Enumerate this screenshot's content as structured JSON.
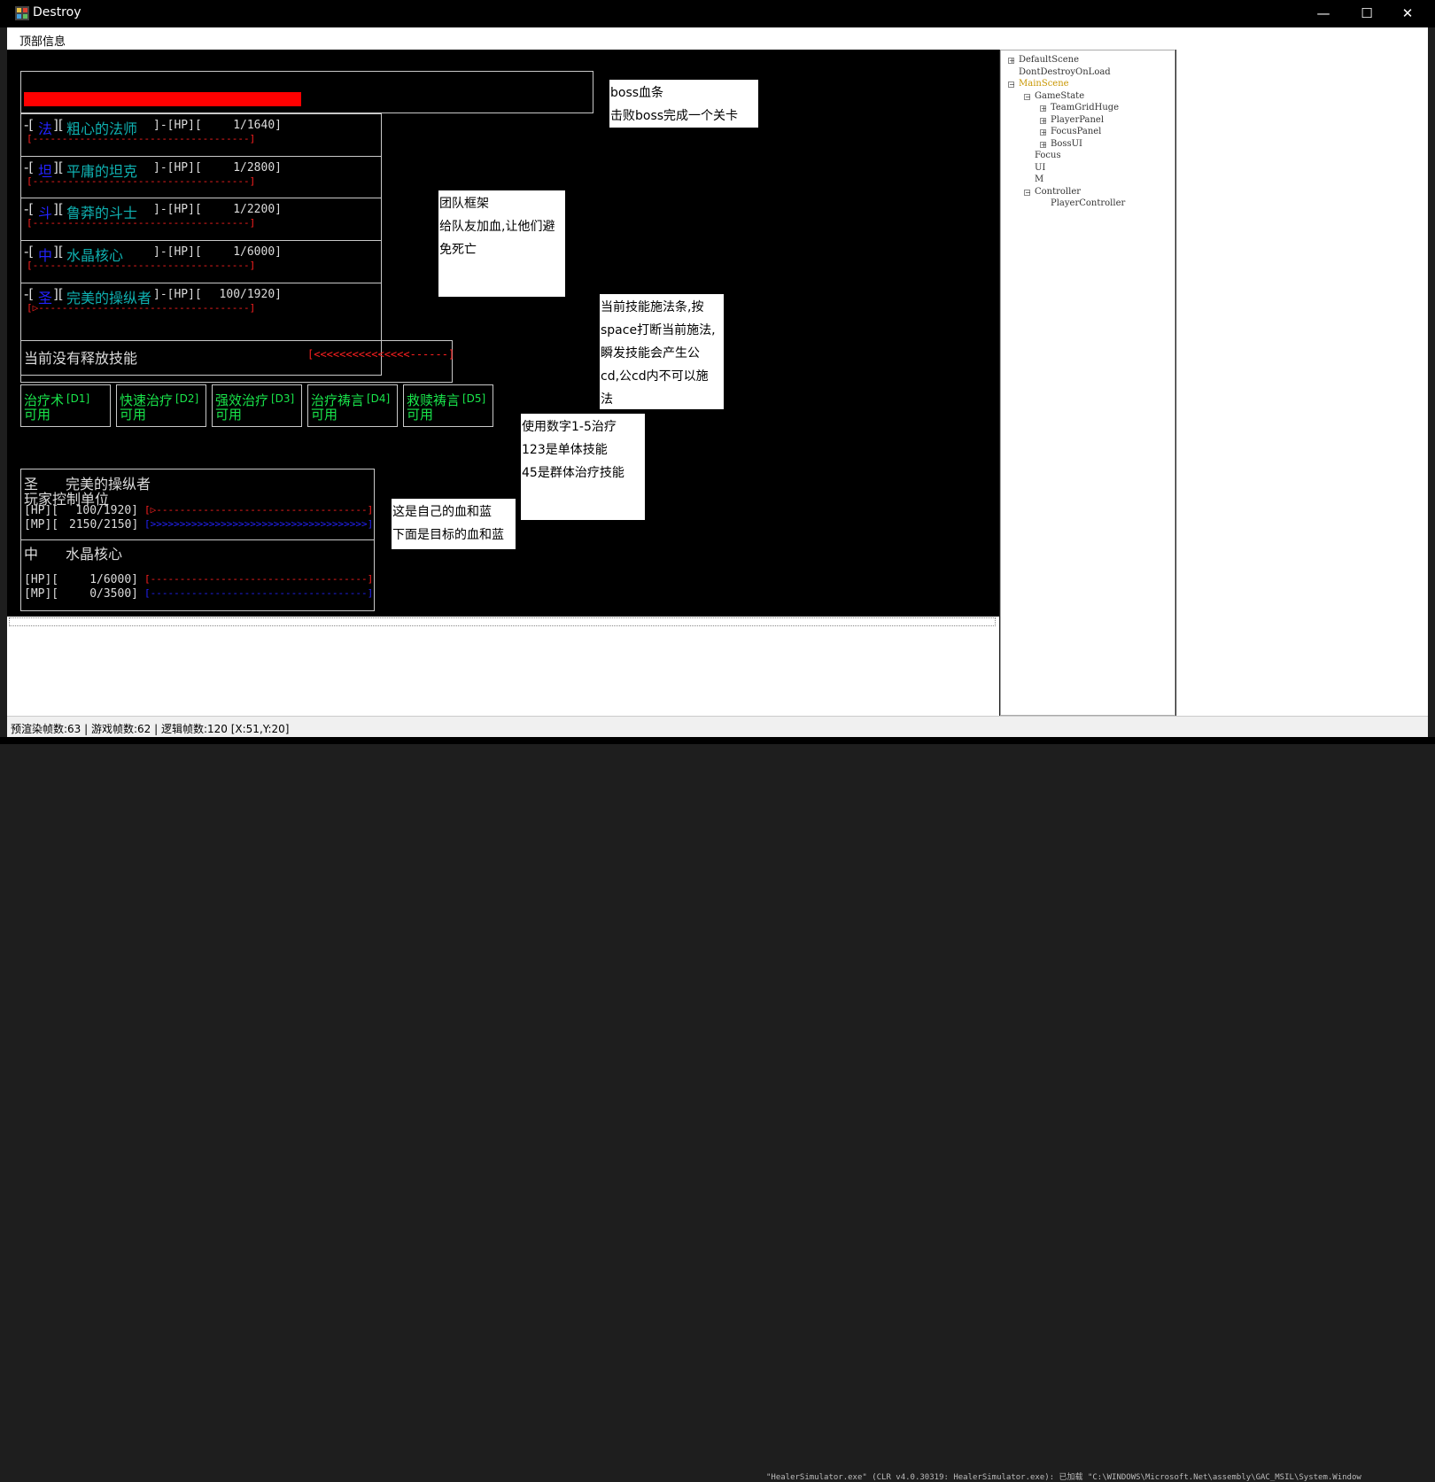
{
  "window": {
    "title": "Destroy",
    "minimize": "—",
    "maximize": "☐",
    "close": "✕"
  },
  "menu": {
    "top_info": "顶部信息"
  },
  "boss": {
    "hp_fraction": 0.49
  },
  "team": [
    {
      "bracket_open": "-[",
      "role": "法",
      "mid": "][",
      "name": "粗心的法师",
      "hp_label": "]-[HP][",
      "hp": "1/1640]",
      "bar": "[-------------------------------------]",
      "hp_fraction": 0.001
    },
    {
      "bracket_open": "-[",
      "role": "坦",
      "mid": "][",
      "name": "平庸的坦克",
      "hp_label": "]-[HP][",
      "hp": "1/2800]",
      "bar": "[-------------------------------------]",
      "hp_fraction": 0.001
    },
    {
      "bracket_open": "-[",
      "role": "斗",
      "mid": "][",
      "name": "鲁莽的斗士",
      "hp_label": "]-[HP][",
      "hp": "1/2200]",
      "bar": "[-------------------------------------]",
      "hp_fraction": 0.001
    },
    {
      "bracket_open": "-[",
      "role": "中",
      "mid": "][",
      "name": "水晶核心",
      "hp_label": "]-[HP][",
      "hp": "1/6000]",
      "bar": "[-------------------------------------]",
      "hp_fraction": 0.001
    },
    {
      "bracket_open": "-[",
      "role": "圣",
      "mid": "][",
      "name": "完美的操纵者",
      "hp_label": "]-[HP][",
      "hp": "100/1920]",
      "bar": "[▷------------------------------------]",
      "hp_fraction": 0.05
    }
  ],
  "cast": {
    "status": "当前没有释放技能",
    "bar": "[<<<<<<<<<<<<<<<------]"
  },
  "skills": [
    {
      "name": "治疗术",
      "key": "[D1]",
      "state": "可用"
    },
    {
      "name": "快速治疗",
      "key": "[D2]",
      "state": "可用"
    },
    {
      "name": "强效治疗",
      "key": "[D3]",
      "state": "可用"
    },
    {
      "name": "治疗祷言",
      "key": "[D4]",
      "state": "可用"
    },
    {
      "name": "救赎祷言",
      "key": "[D5]",
      "state": "可用"
    }
  ],
  "self": {
    "role": "圣",
    "name": "完美的操纵者",
    "type": "玩家控制单位",
    "hp_label": "[HP][",
    "hp": "100/1920]",
    "hp_bar": "[▷------------------------------------]",
    "mp_label": "[MP][",
    "mp": "2150/2150]",
    "mp_bar": "[>>>>>>>>>>>>>>>>>>>>>>>>>>>>>>>>>>>>>]"
  },
  "target": {
    "role": "中",
    "name": "水晶核心",
    "hp_label": "[HP][",
    "hp": "1/6000]",
    "hp_bar": "[-------------------------------------]",
    "mp_label": "[MP][",
    "mp": "0/3500]",
    "mp_bar": "[-------------------------------------]"
  },
  "notes": {
    "boss": "boss血条\n击败boss完成一个关卡",
    "team": "团队框架\n给队友加血,让他们避\n免死亡",
    "cast": "当前技能施法条,按\nspace打断当前施法,\n瞬发技能会产生公\ncd,公cd内不可以施\n法",
    "skills": "使用数字1-5治疗\n123是单体技能\n45是群体治疗技能",
    "self": "这是自己的血和蓝\n下面是目标的血和蓝"
  },
  "tree": [
    {
      "label": "DefaultScene",
      "box": "+"
    },
    {
      "label": "DontDestroyOnLoad",
      "box": ""
    },
    {
      "label": "MainScene",
      "box": "-"
    },
    {
      "label": "GameState",
      "box": "-"
    },
    {
      "label": "TeamGridHuge",
      "box": "+"
    },
    {
      "label": "PlayerPanel",
      "box": "+"
    },
    {
      "label": "FocusPanel",
      "box": "+"
    },
    {
      "label": "BossUI",
      "box": "+"
    },
    {
      "label": "Focus",
      "box": ""
    },
    {
      "label": "UI",
      "box": ""
    },
    {
      "label": "M",
      "box": ""
    },
    {
      "label": "Controller",
      "box": "-"
    },
    {
      "label": "PlayerController",
      "box": ""
    }
  ],
  "tree_colors": {
    "active": "#c89600",
    "normal": "#333333"
  },
  "status": "预渲染帧数:63 | 游戏帧数:62 | 逻辑帧数:120   [X:51,Y:20]",
  "background_log": "\"HealerSimulator.exe\" (CLR v4.0.30319: HealerSimulator.exe): 已加载 \"C:\\WINDOWS\\Microsoft.Net\\assembly\\GAC_MSIL\\System.Window"
}
